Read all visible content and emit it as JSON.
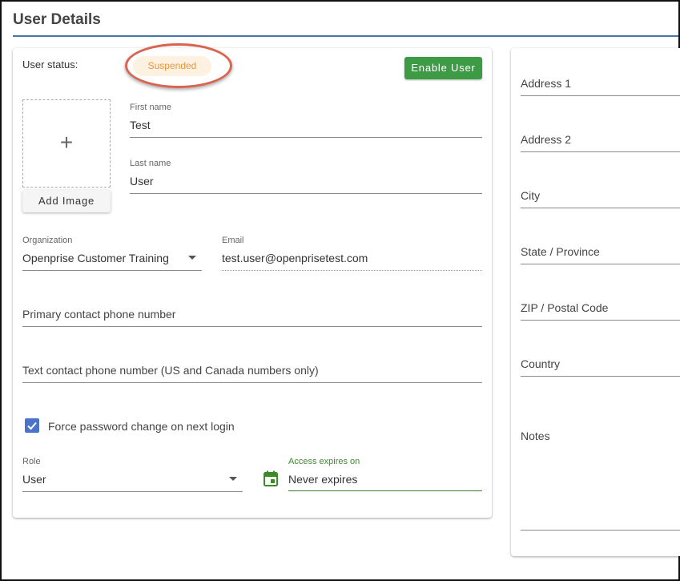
{
  "page": {
    "title": "User Details"
  },
  "status": {
    "label": "User status:",
    "badge": "Suspended",
    "enable_button": "Enable User"
  },
  "image": {
    "add_button": "Add Image"
  },
  "fields": {
    "first_name": {
      "label": "First name",
      "value": "Test"
    },
    "last_name": {
      "label": "Last name",
      "value": "User"
    },
    "organization": {
      "label": "Organization",
      "value": "Openprise Customer Training"
    },
    "email": {
      "label": "Email",
      "value": "test.user@openprisetest.com"
    },
    "primary_phone": {
      "placeholder": "Primary contact phone number"
    },
    "text_phone": {
      "placeholder": "Text contact phone number (US and Canada numbers only)"
    },
    "force_password": {
      "label": "Force password change on next login",
      "checked": true
    },
    "role": {
      "label": "Role",
      "value": "User"
    },
    "access_expires": {
      "label": "Access expires on",
      "value": "Never expires"
    }
  },
  "address": {
    "address1": "Address 1",
    "address2": "Address 2",
    "city": "City",
    "state": "State / Province",
    "zip": "ZIP / Postal Code",
    "country": "Country",
    "notes": "Notes"
  },
  "colors": {
    "accent_green": "#3d9b46",
    "badge_text": "#e8963a",
    "checkbox": "#4a73c9",
    "title_rule": "#4a74a8"
  },
  "icons": {
    "add_image": "plus-icon",
    "dropdown": "caret-down-icon",
    "calendar": "calendar-icon",
    "checkbox": "check-icon"
  }
}
